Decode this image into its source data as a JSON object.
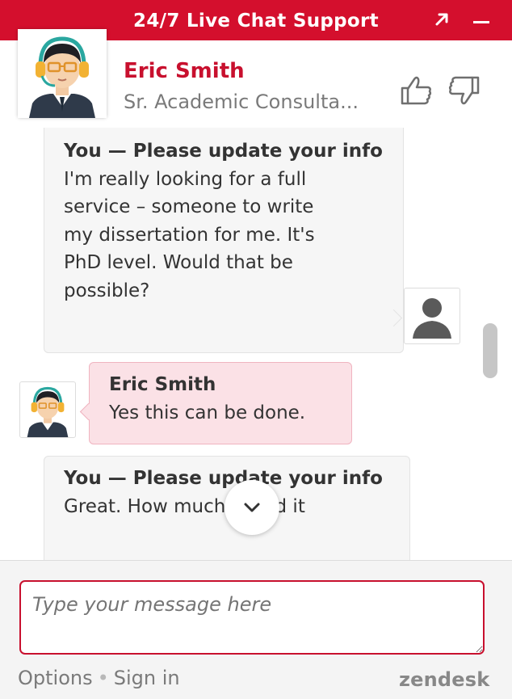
{
  "window": {
    "title": "24/7 Live Chat Support",
    "popout_icon": "arrow-up-right-icon",
    "minimize_icon": "minimize-icon"
  },
  "agent": {
    "name": "Eric Smith",
    "title": "Sr. Academic Consulta...",
    "rate_up_icon": "thumbs-up-icon",
    "rate_down_icon": "thumbs-down-icon"
  },
  "messages": [
    {
      "sender": "You — Please update your info",
      "lines": [
        "I'm really looking for a full",
        "service – someone to write",
        "my dissertation for me. It's",
        "PhD level. Would that be",
        "possible?"
      ]
    },
    {
      "sender": "Eric Smith",
      "lines": [
        "Yes this can be done."
      ]
    },
    {
      "sender": "You — Please update your info",
      "lines": [
        "Great. How much would it"
      ]
    }
  ],
  "composer": {
    "placeholder": "Type your message here"
  },
  "footer": {
    "options": "Options",
    "separator": "•",
    "sign_in": "Sign in",
    "brand": "zendesk"
  },
  "colors": {
    "brand_red": "#d40f2d",
    "agent_bubble": "#fbe1e6",
    "user_bubble": "#f6f6f6"
  }
}
